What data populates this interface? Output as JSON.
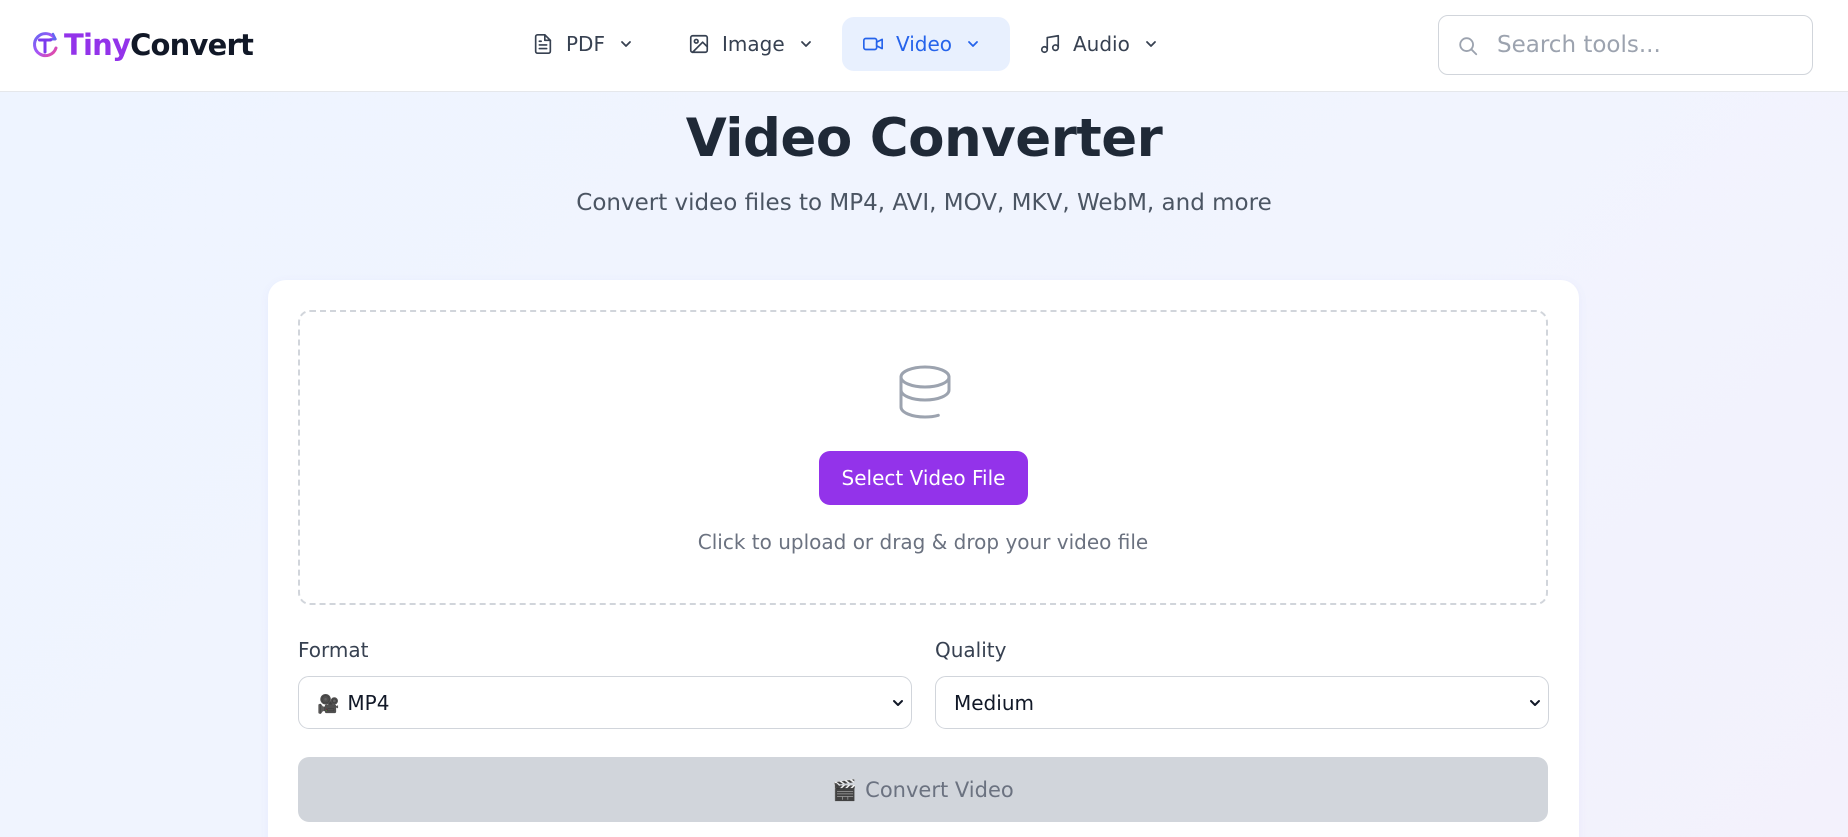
{
  "brand": {
    "name_part1": "Tiny",
    "name_part2": "Convert",
    "accent_color": "#9333ea",
    "logo_icon": "tinyconvert-logo-icon"
  },
  "nav": {
    "items": [
      {
        "label": "PDF",
        "icon": "file-text-icon",
        "active": false
      },
      {
        "label": "Image",
        "icon": "image-icon",
        "active": false
      },
      {
        "label": "Video",
        "icon": "video-camera-icon",
        "active": true
      },
      {
        "label": "Audio",
        "icon": "music-note-icon",
        "active": false
      }
    ],
    "active_color": "#2563eb"
  },
  "search": {
    "placeholder": "Search tools...",
    "value": ""
  },
  "page": {
    "title": "Video Converter",
    "subtitle": "Convert video files to MP4, AVI, MOV, MKV, WebM, and more"
  },
  "upload": {
    "icon": "database-icon",
    "button_label": "Select Video File",
    "hint": "Click to upload or drag & drop your video file"
  },
  "options": {
    "format_label": "Format",
    "format_emoji": "🎥",
    "format_value": "MP4",
    "quality_label": "Quality",
    "quality_value": "Medium"
  },
  "action": {
    "convert_emoji": "🎬",
    "convert_label": "Convert Video",
    "disabled": true
  }
}
